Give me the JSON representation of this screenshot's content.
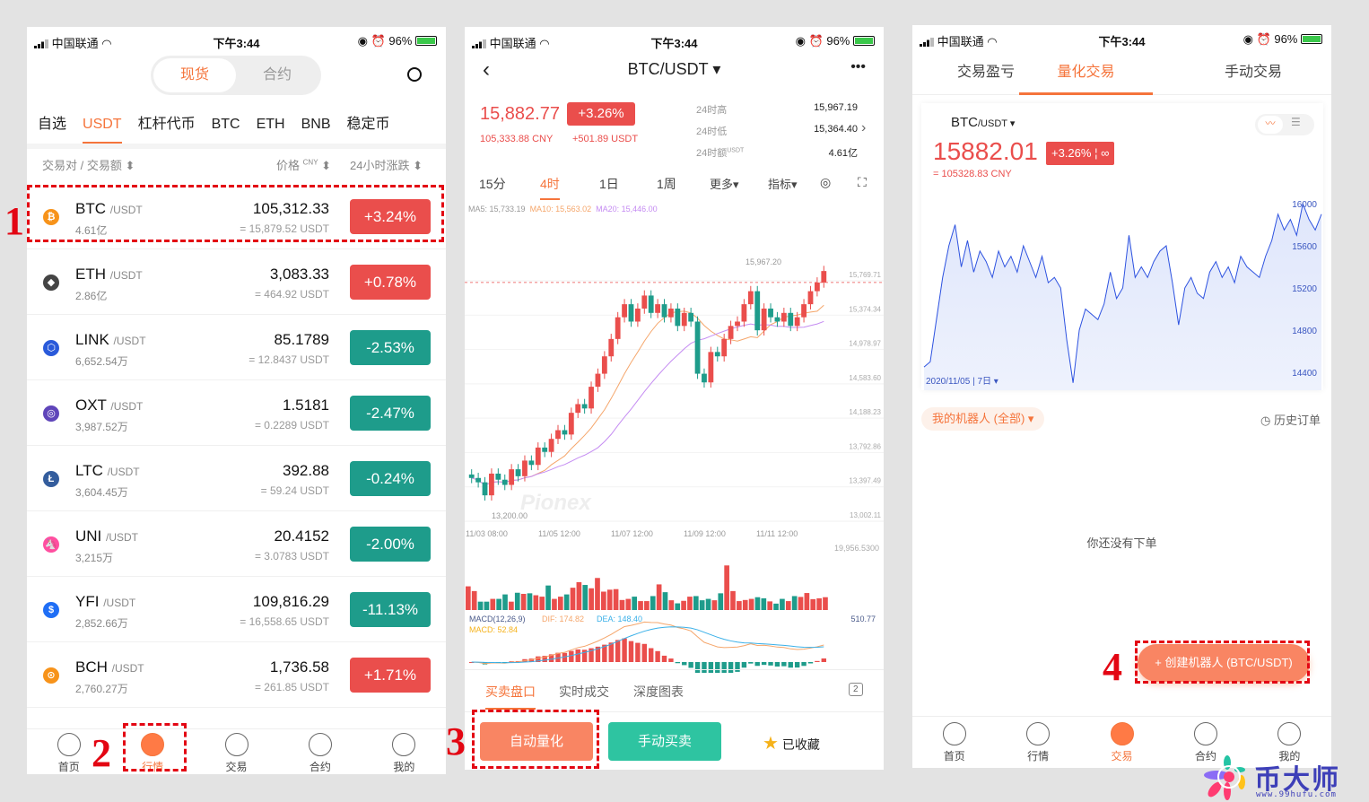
{
  "status": {
    "carrier": "中国联通",
    "time": "下午3:44",
    "battery": "96%"
  },
  "colors": {
    "up": "#ea4e4c",
    "down": "#1e9c8b",
    "accent": "#f5743b",
    "annotation": "#e30613"
  },
  "p1": {
    "segments": [
      "现货",
      "合约"
    ],
    "tabs": [
      "自选",
      "USDT",
      "杠杆代币",
      "BTC",
      "ETH",
      "BNB",
      "稳定币"
    ],
    "header": {
      "pair": "交易对 / 交易额",
      "price": "价格",
      "price_unit": "CNY",
      "change": "24小时涨跌"
    },
    "rows": [
      {
        "sym": "BTC",
        "quote": "/USDT",
        "vol": "4.61亿",
        "price": "105,312.33",
        "usdt": "= 15,879.52 USDT",
        "chg": "+3.24%",
        "dir": "up",
        "icon": "bitcoin-icon",
        "iconColor": "#f7931a",
        "glyph": "₿"
      },
      {
        "sym": "ETH",
        "quote": "/USDT",
        "vol": "2.86亿",
        "price": "3,083.33",
        "usdt": "= 464.92 USDT",
        "chg": "+0.78%",
        "dir": "up",
        "icon": "ethereum-icon",
        "iconColor": "#444",
        "glyph": "◆"
      },
      {
        "sym": "LINK",
        "quote": "/USDT",
        "vol": "6,652.54万",
        "price": "85.1789",
        "usdt": "= 12.8437 USDT",
        "chg": "-2.53%",
        "dir": "down",
        "icon": "chainlink-icon",
        "iconColor": "#2a5ada",
        "glyph": "⬡"
      },
      {
        "sym": "OXT",
        "quote": "/USDT",
        "vol": "3,987.52万",
        "price": "1.5181",
        "usdt": "= 0.2289 USDT",
        "chg": "-2.47%",
        "dir": "down",
        "icon": "orchid-icon",
        "iconColor": "#5f45ba",
        "glyph": "◎"
      },
      {
        "sym": "LTC",
        "quote": "/USDT",
        "vol": "3,604.45万",
        "price": "392.88",
        "usdt": "= 59.24 USDT",
        "chg": "-0.24%",
        "dir": "down",
        "icon": "litecoin-icon",
        "iconColor": "#345d9d",
        "glyph": "Ł"
      },
      {
        "sym": "UNI",
        "quote": "/USDT",
        "vol": "3,215万",
        "price": "20.4152",
        "usdt": "= 3.0783 USDT",
        "chg": "-2.00%",
        "dir": "down",
        "icon": "uniswap-icon",
        "iconColor": "#ff4fa0",
        "glyph": "🦄"
      },
      {
        "sym": "YFI",
        "quote": "/USDT",
        "vol": "2,852.66万",
        "price": "109,816.29",
        "usdt": "= 16,558.65 USDT",
        "chg": "-11.13%",
        "dir": "down",
        "icon": "yearn-icon",
        "iconColor": "#1f6ef5",
        "glyph": "$"
      },
      {
        "sym": "BCH",
        "quote": "/USDT",
        "vol": "2,760.27万",
        "price": "1,736.58",
        "usdt": "= 261.85 USDT",
        "chg": "+1.71%",
        "dir": "up",
        "icon": "bitcoin-cash-icon",
        "iconColor": "#f7931a",
        "glyph": "⊙"
      }
    ],
    "nav": [
      "首页",
      "行情",
      "交易",
      "合约",
      "我的"
    ],
    "marks": [
      "1",
      "2"
    ]
  },
  "p2": {
    "title": "BTC/USDT ▾",
    "more": "•••",
    "price": "15,882.77",
    "badge": "+3.26%",
    "cny": "105,333.88 CNY",
    "delta": "+501.89 USDT",
    "stats": [
      {
        "k": "24时高",
        "v": "15,967.19"
      },
      {
        "k": "24时低",
        "v": "15,364.40"
      },
      {
        "k": "24时额",
        "unit": "USDT",
        "v": "4.61亿"
      }
    ],
    "intervals": [
      "15分",
      "4时",
      "1日",
      "1周",
      "更多▾",
      "指标▾"
    ],
    "ma": {
      "ma5": "MA5: 15,733.19",
      "ma10": "MA10: 15,563.02",
      "ma20": "MA20: 15,446.00"
    },
    "watermark": "Pionex",
    "tabs": [
      "买卖盘口",
      "实时成交",
      "深度图表"
    ],
    "btn_auto": "自动量化",
    "btn_manual": "手动买卖",
    "fav": "已收藏",
    "mark": "3",
    "chart_data": {
      "type": "candlestick",
      "y_ticks": [
        "15,769.71",
        "15,374.34",
        "14,978.97",
        "14,583.60",
        "14,188.23",
        "13,792.86",
        "13,397.49",
        "13,002.11"
      ],
      "ylim": [
        13002.11,
        15769.71
      ],
      "x_ticks": [
        "11/03 08:00",
        "11/05 12:00",
        "11/07 12:00",
        "11/09 12:00",
        "11/11 12:00"
      ],
      "high_label": "15,967.20",
      "low_label": "13,200.00",
      "close": [
        13500,
        13450,
        13300,
        13550,
        13480,
        13420,
        13600,
        13520,
        13700,
        13650,
        13850,
        13800,
        13950,
        14050,
        14000,
        14250,
        14350,
        14300,
        14550,
        14700,
        14900,
        15100,
        15350,
        15500,
        15300,
        15450,
        15600,
        15400,
        15500,
        15350,
        15450,
        15250,
        15400,
        15300,
        14700,
        14600,
        14950,
        14900,
        15100,
        15250,
        15300,
        15500,
        15650,
        15200,
        15450,
        15350,
        15300,
        15400,
        15250,
        15350,
        15500,
        15650,
        15750,
        15882
      ],
      "volume_max_label": "19,956.5300",
      "volume": [
        8500,
        6800,
        3000,
        3000,
        4000,
        4000,
        5600,
        3000,
        6200,
        5800,
        6000,
        5300,
        4800,
        8800,
        4000,
        4800,
        5600,
        8000,
        10000,
        9000,
        7800,
        11500,
        6600,
        7300,
        7500,
        3600,
        4000,
        4800,
        3200,
        3200,
        5000,
        9200,
        6400,
        3500,
        2400,
        3300,
        4800,
        5000,
        3500,
        4000,
        3500,
        6000,
        16000,
        6800,
        3200,
        3600,
        4000,
        4600,
        4200,
        3100,
        2300,
        4000,
        3200,
        5000,
        4700,
        6100,
        3900,
        4200,
        4600
      ],
      "macd_label": "MACD(12,26,9)",
      "dif": "DIF: 174.82",
      "dea": "DEA: 148.40",
      "macd": "MACD: 52.84",
      "macd_max": "510.77",
      "macd_min": "-241.84"
    }
  },
  "p3": {
    "tabs": [
      "交易盈亏",
      "量化交易",
      "手动交易"
    ],
    "pair": "BTC",
    "quote": "/USDT ▾",
    "price": "15882.01",
    "badge": "+3.26%",
    "cny": "= 105328.83 CNY",
    "range": "2020/11/05 | 7日 ▾",
    "bots": "我的机器人 (全部) ▾",
    "history": "历史订单",
    "empty": "你还没有下单",
    "create": "+ 创建机器人 (BTC/USDT)",
    "nav": [
      "首页",
      "行情",
      "交易",
      "合约",
      "我的"
    ],
    "mark": "4",
    "chart_data": {
      "type": "area",
      "y_ticks": [
        "16000",
        "15600",
        "15200",
        "14800",
        "14400"
      ],
      "ylim": [
        14300,
        16200
      ],
      "values": [
        14450,
        14500,
        14900,
        15300,
        15600,
        15800,
        15400,
        15650,
        15350,
        15550,
        15450,
        15300,
        15550,
        15400,
        15500,
        15350,
        15600,
        15450,
        15300,
        15500,
        15250,
        15300,
        15200,
        14700,
        14300,
        14800,
        15000,
        14950,
        14900,
        15050,
        15350,
        15100,
        15200,
        15700,
        15300,
        15400,
        15300,
        15450,
        15550,
        15600,
        15250,
        14850,
        15200,
        15300,
        15150,
        15100,
        15350,
        15450,
        15300,
        15400,
        15250,
        15500,
        15400,
        15350,
        15300,
        15500,
        15650,
        15900,
        15750,
        15850,
        15700,
        16000,
        15850,
        15750,
        15900
      ]
    },
    "logo": {
      "name": "币大师",
      "url": "www.99hufu.com"
    }
  }
}
